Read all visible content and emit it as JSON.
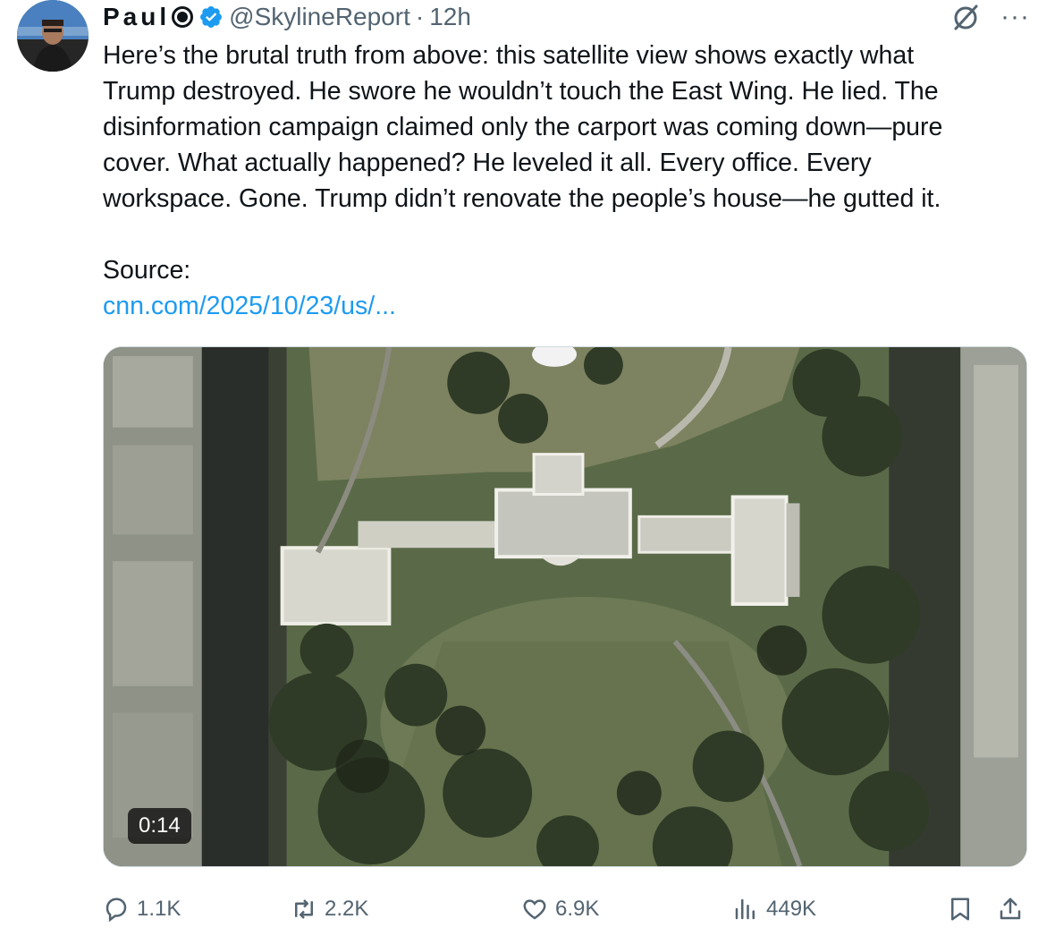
{
  "author": {
    "name": "Paul",
    "handle": "@SkylineReport",
    "separator": "·",
    "time": "12h"
  },
  "icons": {
    "verified": "verified-badge-icon",
    "grok": "grok-slash-icon",
    "more": "more-icon",
    "reply": "reply-icon",
    "repost": "repost-icon",
    "like": "like-icon",
    "views": "views-icon",
    "bookmark": "bookmark-icon",
    "share": "share-icon"
  },
  "colors": {
    "link": "#1d9bf0",
    "verified": "#1d9bf0",
    "muted": "#536471"
  },
  "tweet": {
    "text": "Here’s the brutal truth from above: this satellite view shows exactly what\nTrump destroyed. He swore he wouldn’t touch the East Wing. He lied. The\ndisinformation campaign claimed only the carport was coming down—pure\ncover. What actually happened? He leveled it all. Every office. Every\nworkspace. Gone. Trump didn’t renovate the people’s house—he gutted it.",
    "source_label": "Source:",
    "link_text": "cnn.com/2025/10/23/us/..."
  },
  "media": {
    "duration": "0:14"
  },
  "actions": {
    "replies": "1.1K",
    "reposts": "2.2K",
    "likes": "6.9K",
    "views": "449K"
  }
}
